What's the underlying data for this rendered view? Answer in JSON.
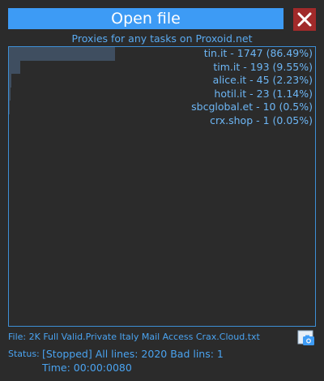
{
  "header": {
    "open_button_label": "Open file",
    "close_icon": "close-icon",
    "subtitle": "Proxies for any tasks on Proxoid.net"
  },
  "colors": {
    "accent": "#3d9bf5",
    "close_bg": "#a12a2a",
    "background": "#2b2b2b",
    "bar": "#3f4e60"
  },
  "domains": [
    {
      "label": "tin.it - 1747 (86.49%)",
      "percent": 86.49
    },
    {
      "label": "tim.it - 193 (9.55%)",
      "percent": 9.55
    },
    {
      "label": "alice.it - 45 (2.23%)",
      "percent": 2.23
    },
    {
      "label": "hotil.it - 23 (1.14%)",
      "percent": 1.14
    },
    {
      "label": "sbcglobal.et - 10 (0.5%)",
      "percent": 0.5
    },
    {
      "label": "crx.shop - 1 (0.05%)",
      "percent": 0.05
    }
  ],
  "footer": {
    "file_text": "File: 2K Full Valid.Private Italy Mail Access Crax.Cloud.txt",
    "camera_icon": "camera-icon",
    "status_label": "Status:",
    "status_text": "[Stopped] All lines: 2020 Bad lins: 1",
    "time_text": "Time: 00:00:0080"
  }
}
